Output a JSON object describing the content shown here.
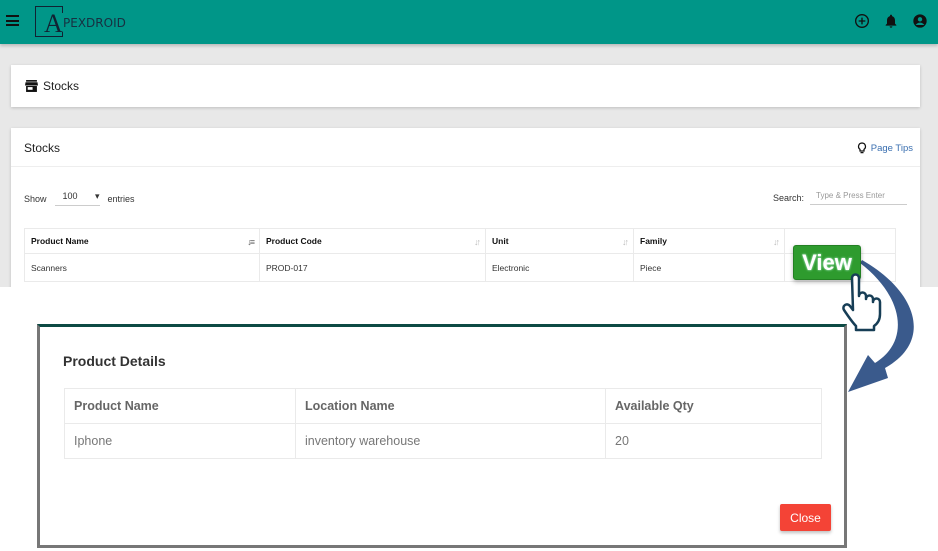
{
  "app": {
    "name": "PEXDROID",
    "logo_letter": "A"
  },
  "topbar": {
    "icons": [
      "menu-icon",
      "add-circle-icon",
      "bell-icon",
      "account-circle-icon"
    ]
  },
  "breadcrumb": {
    "icon": "store-icon",
    "title": "Stocks"
  },
  "stocks_card": {
    "title": "Stocks",
    "page_tips_label": "Page Tips",
    "show_label": "Show",
    "entries_value": "100",
    "entries_label": "entries",
    "search_label": "Search:",
    "search_placeholder": "Type & Press Enter",
    "search_value": "",
    "columns": [
      "Product Name",
      "Product Code",
      "Unit",
      "Family",
      ""
    ],
    "rows": [
      {
        "product_name": "Scanners",
        "product_code": "PROD-017",
        "unit": "Electronic",
        "family": "Piece"
      }
    ]
  },
  "annotation": {
    "view_button_label": "View"
  },
  "modal": {
    "title": "Product Details",
    "columns": [
      "Product Name",
      "Location Name",
      "Available Qty"
    ],
    "rows": [
      {
        "product_name": "Iphone",
        "location_name": "inventory warehouse",
        "available_qty": "20"
      }
    ],
    "close_label": "Close"
  },
  "colors": {
    "topbar": "#009688",
    "view_button": "#2e9b2e",
    "close_button": "#f44336",
    "link": "#3a6fb0",
    "arrow": "#3a5a8c"
  }
}
